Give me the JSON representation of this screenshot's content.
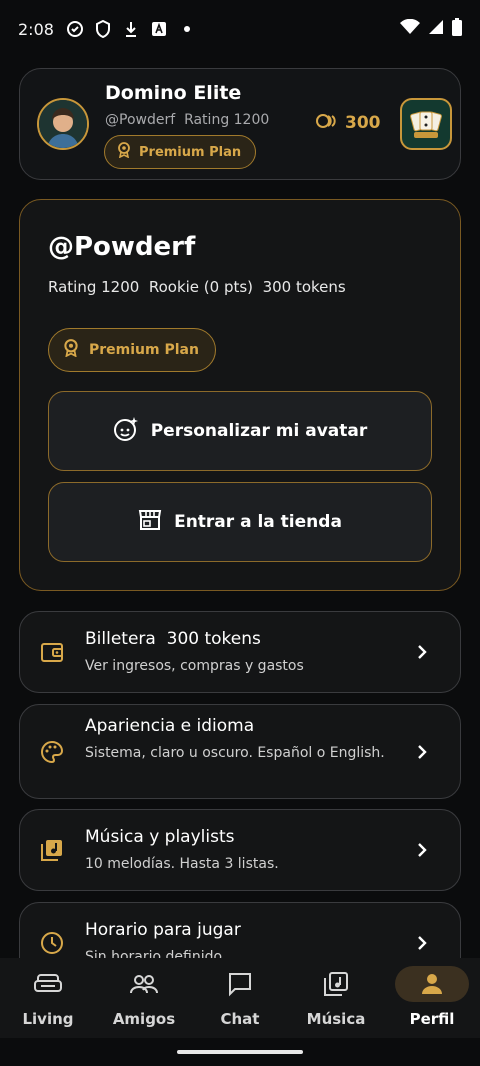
{
  "status_bar": {
    "time": "2:08"
  },
  "header": {
    "name": "Domino Elite",
    "handle": "@Powderf",
    "rating": "Rating 1200",
    "plan": "Premium Plan",
    "coins": "300"
  },
  "profile": {
    "handle": "@Powderf",
    "stats": "Rating 1200  Rookie (0 pts)  300 tokens",
    "plan": "Premium Plan",
    "avatar_button": "Personalizar mi avatar",
    "store_button": "Entrar a la tienda"
  },
  "items": [
    {
      "title": "Billetera  300 tokens",
      "desc": "Ver ingresos, compras y gastos"
    },
    {
      "title": "Apariencia e idioma",
      "desc": "Sistema, claro u oscuro. Español o English."
    },
    {
      "title": "Música y playlists",
      "desc": "10 melodías. Hasta 3 listas."
    },
    {
      "title": "Horario para jugar",
      "desc": "Sin horario definido"
    }
  ],
  "nav": {
    "tabs": [
      {
        "label": "Living"
      },
      {
        "label": "Amigos"
      },
      {
        "label": "Chat"
      },
      {
        "label": "Música"
      },
      {
        "label": "Perfil"
      }
    ],
    "active": "Perfil"
  },
  "colors": {
    "accent": "#d8a84a",
    "background": "#0b0c0d",
    "card": "#141516"
  }
}
